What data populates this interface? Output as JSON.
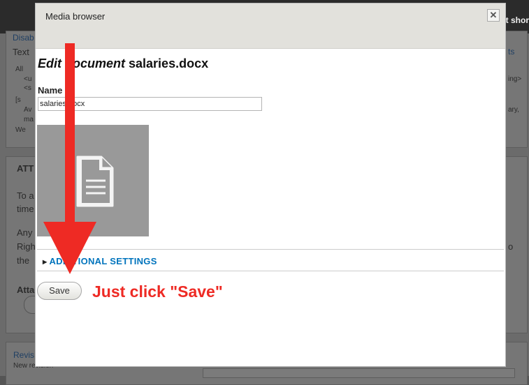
{
  "background": {
    "top_right_text": "it shor",
    "panel1_link": "Disab",
    "panel1_text": "Text",
    "panel1_bullets": [
      "All",
      "<u",
      "<s",
      "[s",
      "Av",
      "ma",
      "We"
    ],
    "right_fragments": [
      "ts",
      "ing>",
      "ary,",
      ""
    ],
    "panel2_title": "ATT",
    "panel2_lines": [
      "To a",
      "time",
      "Any",
      "Righ",
      "the"
    ],
    "right_o": "o",
    "atta_label": "Atta",
    "revision_link": "Revis",
    "revision_sub": "New revision"
  },
  "modal": {
    "title": "Media browser",
    "close_symbol": "✕",
    "heading_em": "Edit document",
    "heading_rest": "salaries.docx",
    "name_label": "Name",
    "name_value": "salaries.docx",
    "thumbnail_icon": "document-icon",
    "fieldset_label": "ADDITIONAL SETTINGS",
    "save_label": "Save"
  },
  "annotation": {
    "text": "Just click \"Save\"",
    "color": "#ee2a24"
  }
}
